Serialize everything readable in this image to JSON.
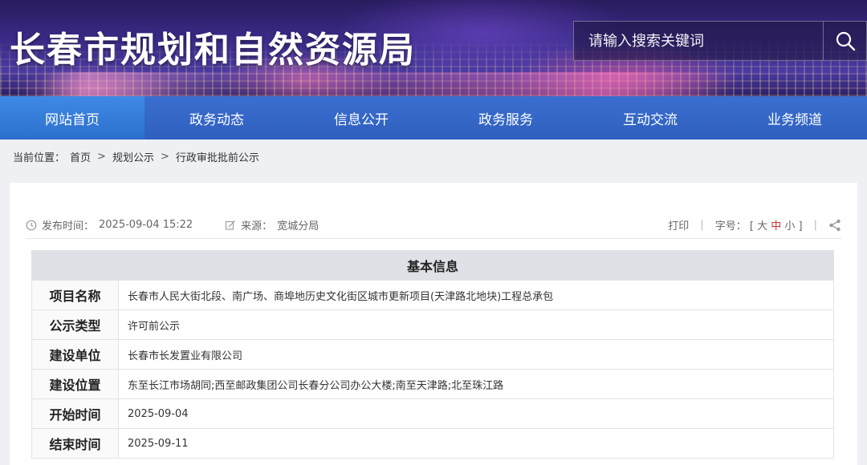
{
  "header": {
    "site_title": "长春市规划和自然资源局",
    "search_placeholder": "请输入搜索关键词"
  },
  "nav": {
    "items": [
      {
        "label": "网站首页",
        "active": true
      },
      {
        "label": "政务动态",
        "active": false
      },
      {
        "label": "信息公开",
        "active": false
      },
      {
        "label": "政务服务",
        "active": false
      },
      {
        "label": "互动交流",
        "active": false
      },
      {
        "label": "业务频道",
        "active": false
      }
    ]
  },
  "breadcrumb": {
    "prefix": "当前位置：",
    "items": [
      "首页",
      "规划公示",
      "行政审批批前公示"
    ],
    "separator": ">"
  },
  "article_meta": {
    "publish_label": "发布时间：",
    "publish_time": "2025-09-04 15:22",
    "source_label": "来源：",
    "source": "宽城分局",
    "print_label": "打印",
    "divider": "|",
    "font_label": "字号：",
    "font_open": "[",
    "font_large": "大",
    "font_medium": "中",
    "font_small": "小",
    "font_close": "]"
  },
  "info_table": {
    "heading": "基本信息",
    "rows": [
      {
        "label": "项目名称",
        "value": "长春市人民大街北段、南广场、商埠地历史文化街区城市更新项目(天津路北地块)工程总承包"
      },
      {
        "label": "公示类型",
        "value": "许可前公示"
      },
      {
        "label": "建设单位",
        "value": "长春市长发置业有限公司"
      },
      {
        "label": "建设位置",
        "value": "东至长江市场胡同;西至邮政集团公司长春分公司办公大楼;南至天津路;北至珠江路"
      },
      {
        "label": "开始时间",
        "value": "2025-09-04"
      },
      {
        "label": "结束时间",
        "value": "2025-09-11"
      }
    ]
  },
  "colors": {
    "nav_bg": "#2f5fbf",
    "nav_active": "#2c6fcc",
    "table_head_bg": "#dfe1e6",
    "font_mid_accent": "#d03030"
  },
  "icons": {
    "search": "search-icon",
    "clock": "clock-icon",
    "edit": "edit-icon",
    "share": "share-icon"
  }
}
